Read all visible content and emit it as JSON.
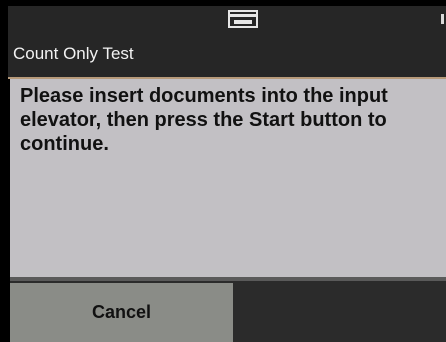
{
  "header": {
    "status_icon": "scanner-tray-icon",
    "title": "Count Only Test"
  },
  "message": {
    "text": "Please insert documents into the input elevator, then press the Start button to continue."
  },
  "actions": {
    "cancel_label": "Cancel"
  },
  "colors": {
    "header_bg": "#262626",
    "message_bg": "#c2c0c4",
    "button_bg": "#8a8c87",
    "action_bar_bg": "#2b2b2b",
    "accent": "#b79a7a"
  }
}
